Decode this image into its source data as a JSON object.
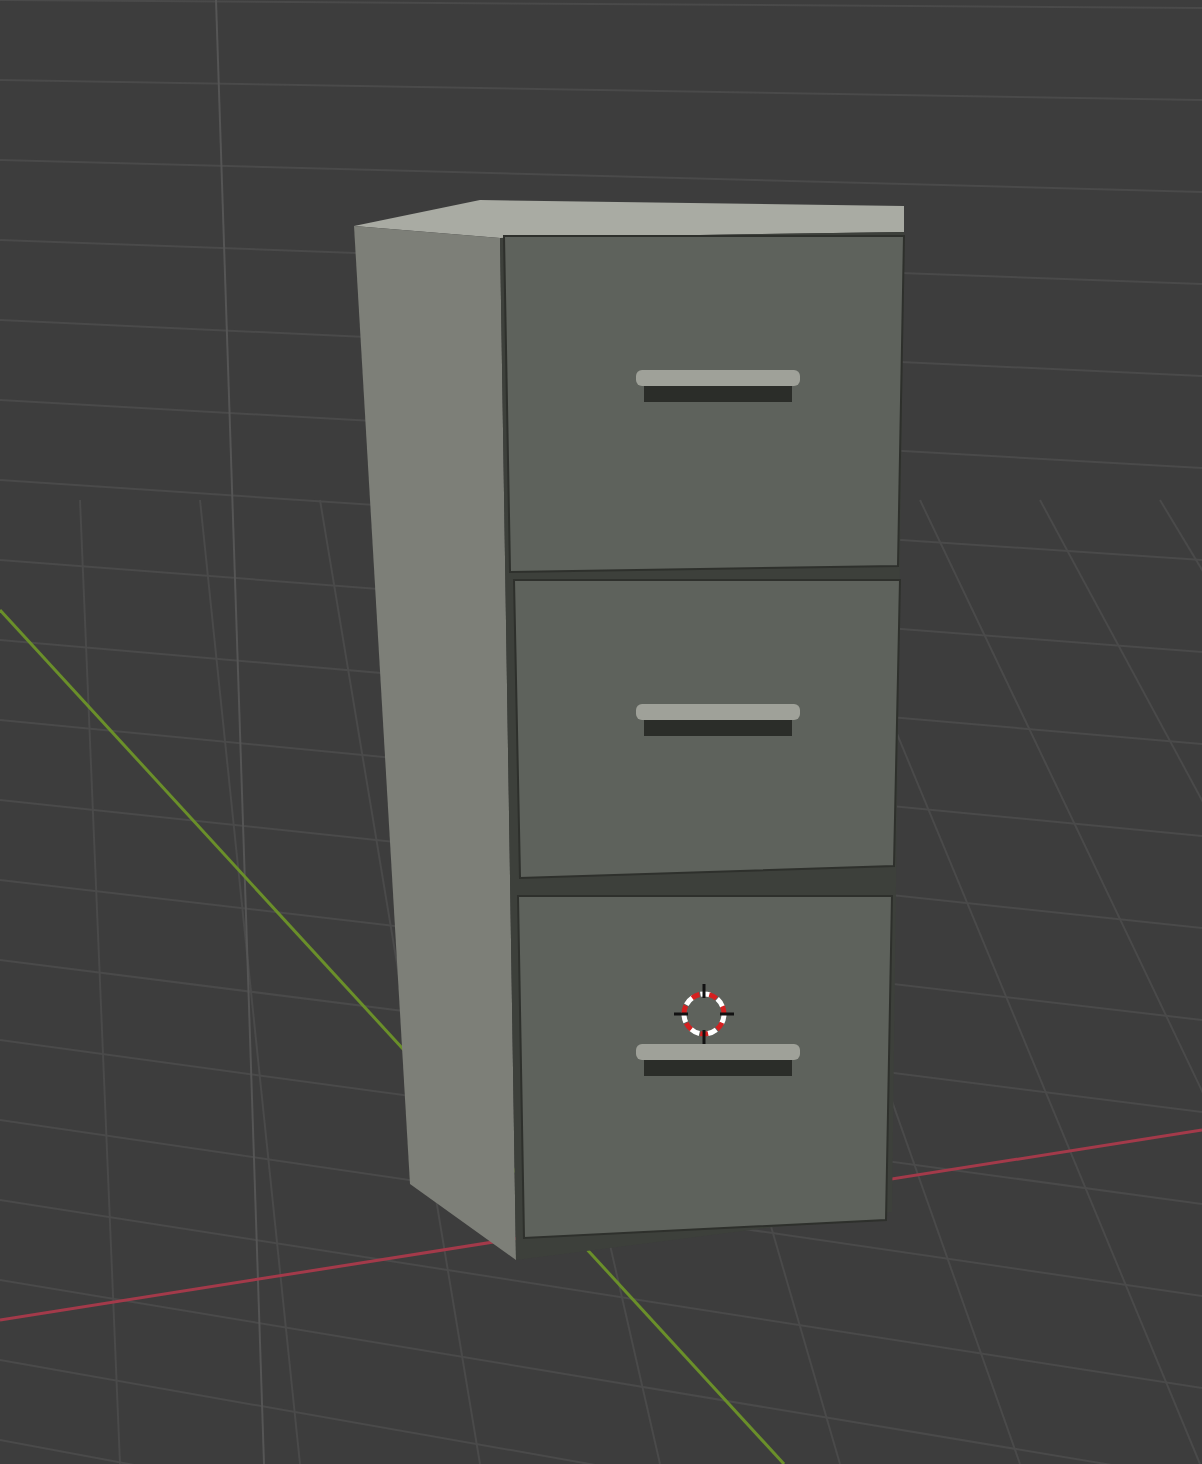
{
  "viewport": {
    "show_grid": true,
    "show_axes": true,
    "show_cursor": true
  }
}
